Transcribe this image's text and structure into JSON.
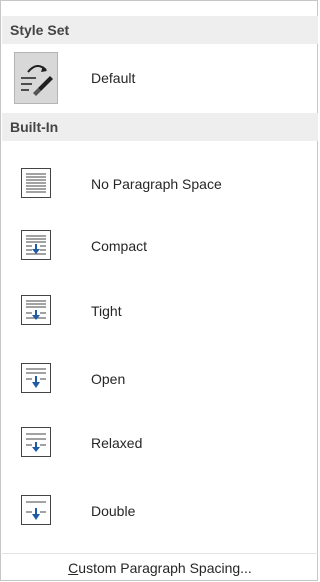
{
  "menu": {
    "style_set_header": "Style Set",
    "default_item": {
      "label": "Default",
      "icon": "paragraph-spacing-brush-icon"
    },
    "builtin_header": "Built-In",
    "builtin_items": [
      {
        "label": "No Paragraph Space",
        "icon": "no-paragraph-space-icon"
      },
      {
        "label": "Compact",
        "icon": "compact-spacing-icon"
      },
      {
        "label": "Tight",
        "icon": "tight-spacing-icon"
      },
      {
        "label": "Open",
        "icon": "open-spacing-icon"
      },
      {
        "label": "Relaxed",
        "icon": "relaxed-spacing-icon"
      },
      {
        "label": "Double",
        "icon": "double-spacing-icon"
      }
    ],
    "custom_link": {
      "access_key": "C",
      "rest": "ustom Paragraph Spacing..."
    }
  },
  "colors": {
    "header_background": "#eeeeee",
    "default_icon_background": "#d8d8d8",
    "arrow_blue": "#1f5ba8"
  }
}
